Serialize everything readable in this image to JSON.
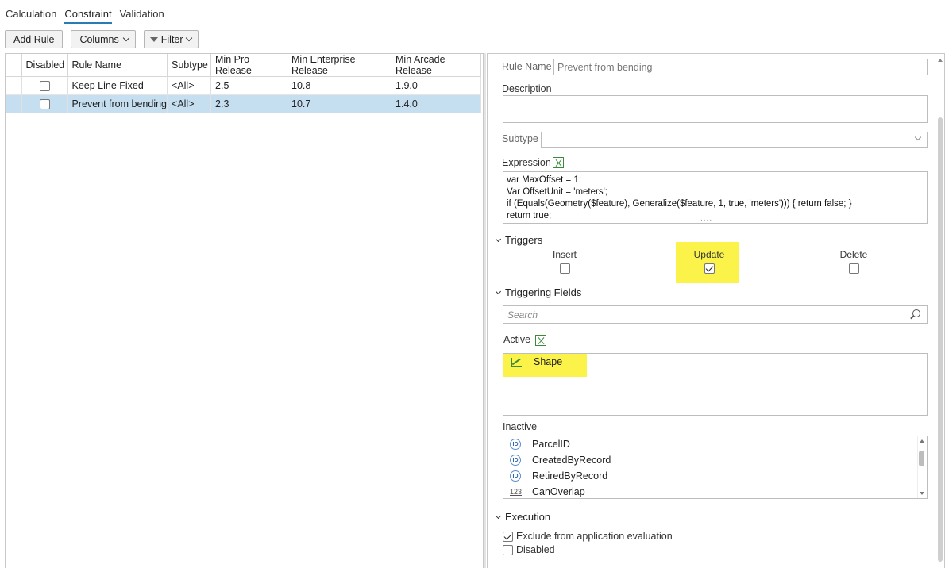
{
  "tabs": [
    {
      "label": "Calculation",
      "active": false
    },
    {
      "label": "Constraint",
      "active": true
    },
    {
      "label": "Validation",
      "active": false
    }
  ],
  "toolbar": {
    "add_rule": "Add Rule",
    "columns": "Columns",
    "filter": "Filter"
  },
  "table": {
    "headers": [
      "Disabled",
      "Rule Name",
      "Subtype",
      "Min Pro Release",
      "Min Enterprise Release",
      "Min Arcade Release"
    ],
    "rows": [
      {
        "disabled": false,
        "rule_name": "Keep Line Fixed",
        "subtype": "<All>",
        "min_pro": "2.5",
        "min_enterprise": "10.8",
        "min_arcade": "1.9.0",
        "selected": false
      },
      {
        "disabled": false,
        "rule_name": "Prevent from bending",
        "subtype": "<All>",
        "min_pro": "2.3",
        "min_enterprise": "10.7",
        "min_arcade": "1.4.0",
        "selected": true
      }
    ]
  },
  "details": {
    "rule_name_label": "Rule Name",
    "rule_name_value": "Prevent from bending",
    "description_label": "Description",
    "description_value": "",
    "subtype_label": "Subtype",
    "subtype_value": "",
    "expression_label": "Expression",
    "expression_lines": [
      "var MaxOffset = 1;",
      "Var OffsetUnit = 'meters';",
      "if (Equals(Geometry($feature), Generalize($feature, 1, true, 'meters'))) { return false; }",
      "return true;"
    ],
    "expression_more": "....",
    "triggers": {
      "title": "Triggers",
      "insert": {
        "label": "Insert",
        "checked": false
      },
      "update": {
        "label": "Update",
        "checked": true
      },
      "delete": {
        "label": "Delete",
        "checked": false
      }
    },
    "triggering_fields": {
      "title": "Triggering Fields",
      "search_placeholder": "Search",
      "active_label": "Active",
      "active_items": [
        {
          "name": "Shape",
          "icon": "shape-icon"
        }
      ],
      "inactive_label": "Inactive",
      "inactive_items": [
        {
          "name": "ParcelID",
          "icon": "id-icon"
        },
        {
          "name": "CreatedByRecord",
          "icon": "id-icon"
        },
        {
          "name": "RetiredByRecord",
          "icon": "id-icon"
        },
        {
          "name": "CanOverlap",
          "icon": "number-icon"
        }
      ]
    },
    "execution": {
      "title": "Execution",
      "exclude": {
        "label": "Exclude from application evaluation",
        "checked": true
      },
      "disabled": {
        "label": "Disabled",
        "checked": false
      }
    }
  },
  "colors": {
    "selection": "#c5dff0",
    "highlight": "#fbf34a",
    "tab_accent": "#2a7ab8"
  },
  "icon_glyphs": {
    "id": "ID",
    "number": "123"
  }
}
